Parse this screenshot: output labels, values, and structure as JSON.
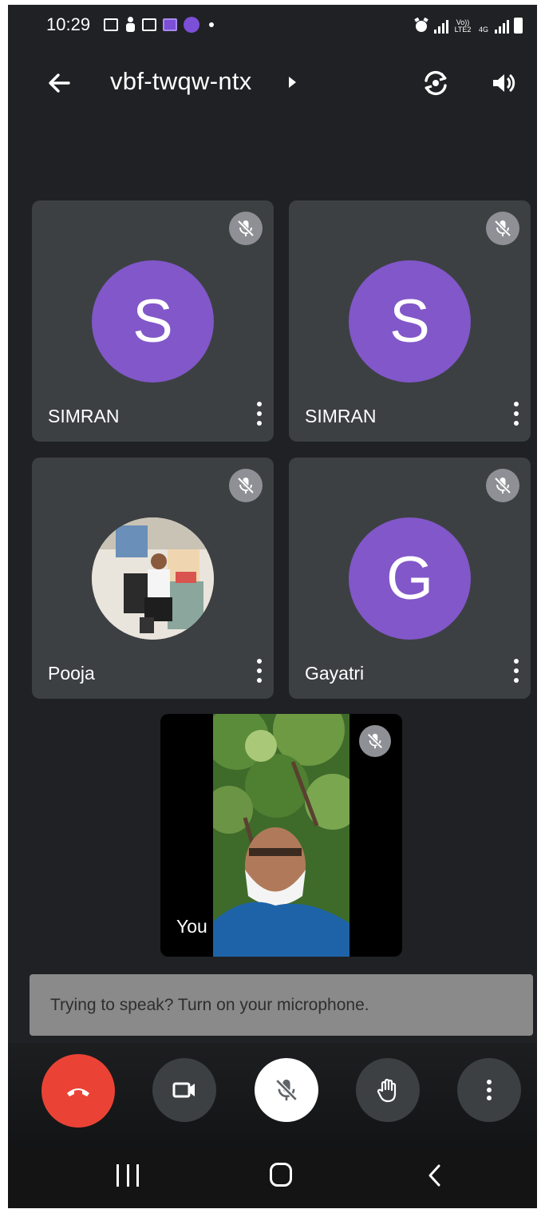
{
  "status_bar": {
    "time": "10:29",
    "icons": [
      "video-call-icon",
      "user-walk-icon",
      "voicemail-icon",
      "infinity-badge-icon",
      "infinity-circle-icon",
      "dot-icon"
    ],
    "right_icons": [
      "alarm-icon",
      "signal-icon",
      "volte-icon",
      "4g-icon",
      "signal-icon",
      "battery-icon"
    ],
    "volte_label": "Vo)) LTE2",
    "net_label": "4G"
  },
  "topbar": {
    "meeting_code": "vbf-twqw-ntx"
  },
  "participants": [
    {
      "name": "SIMRAN",
      "initial": "S",
      "avatar_color": "#8257c9",
      "muted": true
    },
    {
      "name": "SIMRAN",
      "initial": "S",
      "avatar_color": "#8257c9",
      "muted": true
    },
    {
      "name": "Pooja",
      "initial": "",
      "photo": true,
      "muted": true
    },
    {
      "name": "Gayatri",
      "initial": "G",
      "avatar_color": "#8257c9",
      "muted": true
    }
  ],
  "self_view": {
    "label": "You",
    "muted": true
  },
  "toast": {
    "text": "Trying to speak? Turn on your microphone."
  },
  "controls": {
    "end_call_color": "#ea4335",
    "buttons": [
      "end-call",
      "camera",
      "microphone",
      "raise-hand",
      "more-options"
    ]
  },
  "colors": {
    "background": "#202124",
    "tile": "#3c4043",
    "avatar": "#8257c9",
    "end_call": "#ea4335"
  }
}
